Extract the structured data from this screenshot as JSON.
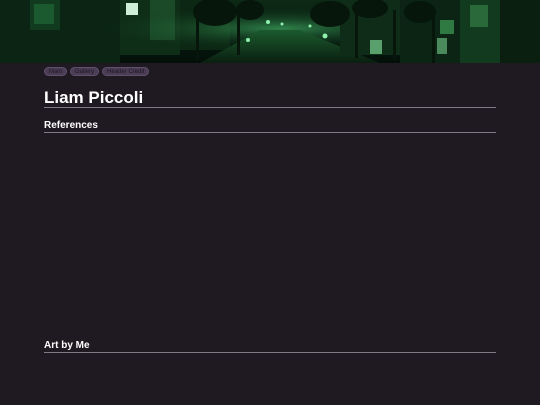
{
  "nav": {
    "items": [
      {
        "label": "Main"
      },
      {
        "label": "Gallery"
      },
      {
        "label": "Header Credit"
      }
    ]
  },
  "page": {
    "title": "Liam Piccoli"
  },
  "sections": {
    "references": {
      "heading": "References"
    },
    "art": {
      "heading": "Art by Me"
    }
  },
  "colors": {
    "background": "#1f1a21",
    "header_tint": "#1f8a3c",
    "button_bg": "#4a3d55",
    "rule": "#807a86"
  }
}
